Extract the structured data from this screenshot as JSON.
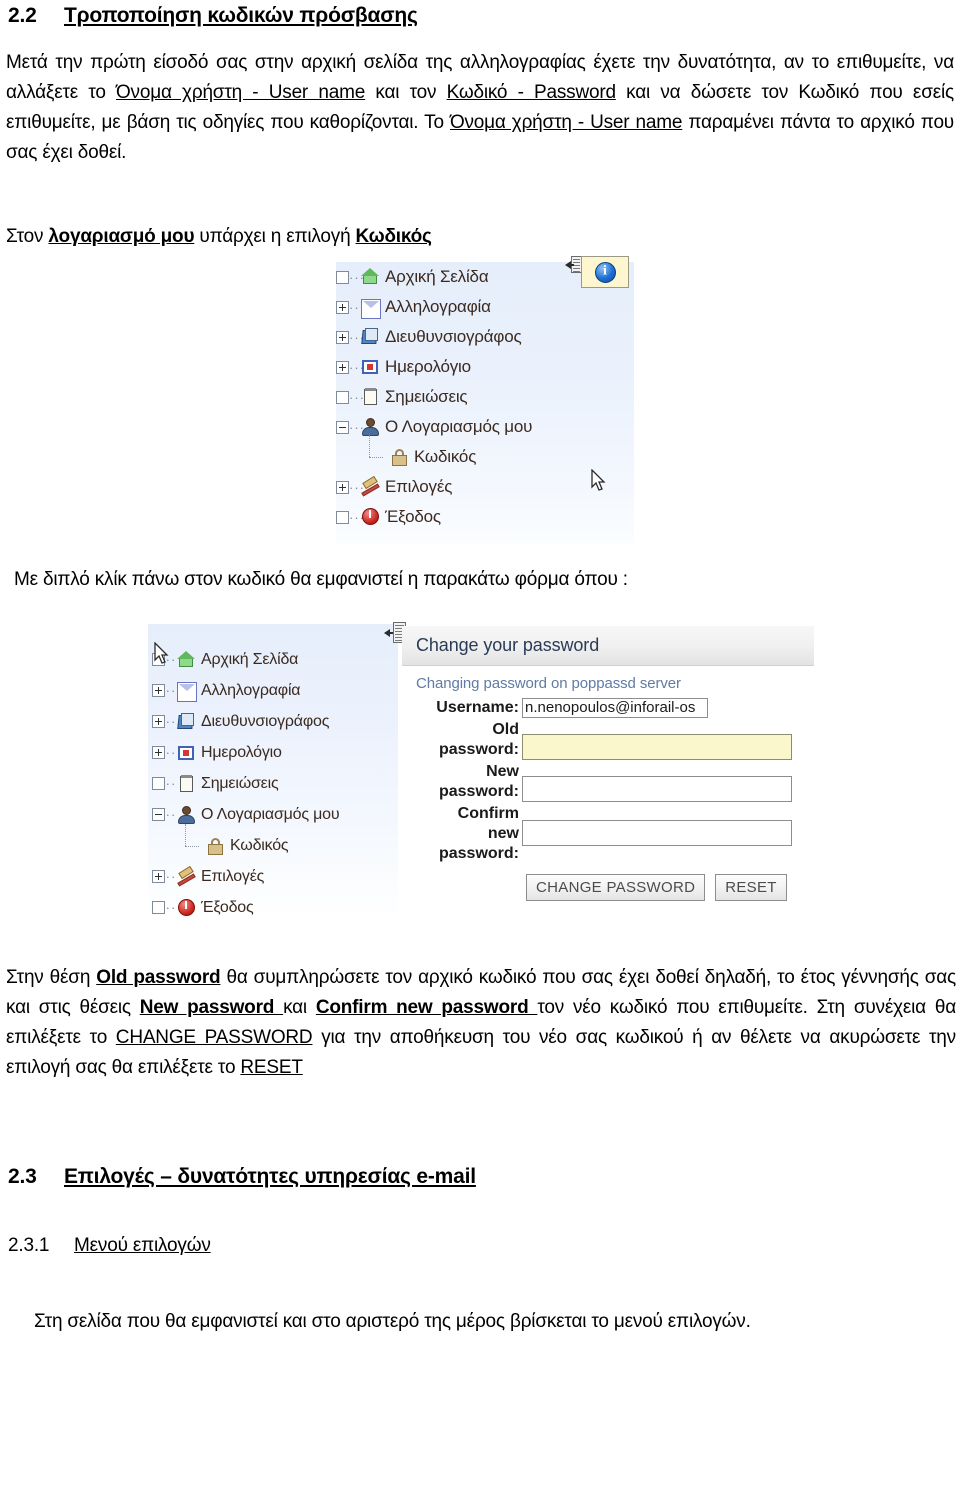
{
  "sections": {
    "s22": {
      "number": "2.2",
      "title": "Τροποποίηση κωδικών πρόσβασης"
    },
    "s23": {
      "number": "2.3",
      "title": "Επιλογές – δυνατότητες  υπηρεσίας e-mail"
    },
    "s231": {
      "number": "2.3.1",
      "title": "Μενού επιλογών"
    }
  },
  "paragraphs": {
    "intro": {
      "p1": "Μετά την πρώτη είσοδό σας στην αρχική  σελίδα της αλληλογραφίας έχετε την δυνατότητα, αν το επιθυμείτε, να αλλάξετε το ",
      "link1": "Όνομα  χρήστη - User name",
      "p2": " και τον ",
      "link2": "Κωδικό - Password",
      "p3": " και να δώσετε τον  Κωδικό που εσείς επιθυμείτε, με βάση τις οδηγίες που καθορίζονται. Το ",
      "link3": "Όνομα  χρήστη - User name",
      "p4": " παραμένει πάντα το αρχικό που σας έχει δοθεί."
    },
    "account": {
      "p1": "Στον ",
      "link1": "λογαριασμό μου",
      "p2": " υπάρχει η επιλογή ",
      "link2": "Κωδικός"
    },
    "dblclick": "Με διπλό κλίκ πάνω στον κωδικό θα εμφανιστεί   η παρακάτω φόρμα όπου :",
    "explain": {
      "p1": "Στην θέση ",
      "link1": "Old password",
      "p2": " θα συμπληρώσετε τον αρχικό κωδικό που σας έχει δοθεί δηλαδή, το έτος γέννησής σας και στις θέσεις ",
      "link2": "New password ",
      "p3": " και  ",
      "link3": "Confirm new password ",
      "p4": " τον νέο κωδικό που επιθυμείτε. Στη συνέχεια θα επιλέξετε  το ",
      "link4": "CHANGE PASSWORD",
      "p5": " για την  αποθήκευση του νέο  σας κωδικού ή αν θέλετε να ακυρώσετε την επιλογή σας θα επιλέξετε το ",
      "link5": "RESET"
    },
    "final": "Στη σελίδα που θα εμφανιστεί και στο αριστερό της μέρος βρίσκεται το μενού επιλογών."
  },
  "screenshot_tree": {
    "nodes": [
      {
        "toggle": "empty",
        "icon": "home-icon",
        "label": "Αρχική Σελίδα"
      },
      {
        "toggle": "plus",
        "icon": "mail-icon",
        "label": "Αλληλογραφία"
      },
      {
        "toggle": "plus",
        "icon": "addressbook-icon",
        "label": "Διευθυνσιογράφος"
      },
      {
        "toggle": "plus",
        "icon": "calendar-icon",
        "label": "Ημερολόγιο"
      },
      {
        "toggle": "empty",
        "icon": "notes-icon",
        "label": "Σημειώσεις"
      },
      {
        "toggle": "minus",
        "icon": "user-icon",
        "label": "Ο Λογαριασμός μου"
      },
      {
        "toggle": "child",
        "icon": "lock-icon",
        "label": "Κωδικός"
      },
      {
        "toggle": "plus",
        "icon": "tools-icon",
        "label": "Επιλογές"
      },
      {
        "toggle": "empty",
        "icon": "power-icon",
        "label": "Έξοδος"
      }
    ],
    "tooltip_icon": "info-icon",
    "splitter_icon": "collapse-panel-icon",
    "cursor_icon": "mouse-pointer-icon"
  },
  "password_form": {
    "panel_title": "Change your password",
    "panel_subtitle": "Changing password on poppassd server",
    "fields": [
      {
        "label_line1": "Username:",
        "label_line2": "",
        "value": "n.nenopoulos@inforail-os",
        "kind": "text"
      },
      {
        "label_line1": "Old",
        "label_line2": "password:",
        "value": "",
        "kind": "old"
      },
      {
        "label_line1": "New",
        "label_line2": "password:",
        "value": "",
        "kind": "new"
      },
      {
        "label_line1": "Confirm",
        "label_line2": "new",
        "label_line3": "password:",
        "value": "",
        "kind": "confirm"
      }
    ],
    "buttons": [
      {
        "label": "CHANGE PASSWORD",
        "name": "change-password-button"
      },
      {
        "label": "RESET",
        "name": "reset-button"
      }
    ]
  },
  "colors": {
    "tree_bg_top": "#e6eefb",
    "old_password_bg": "#fbf7cc",
    "tooltip_bg": "#fdf6cf",
    "panel_subtitle": "#5f7ba6",
    "panel_title": "#2a3c55"
  }
}
